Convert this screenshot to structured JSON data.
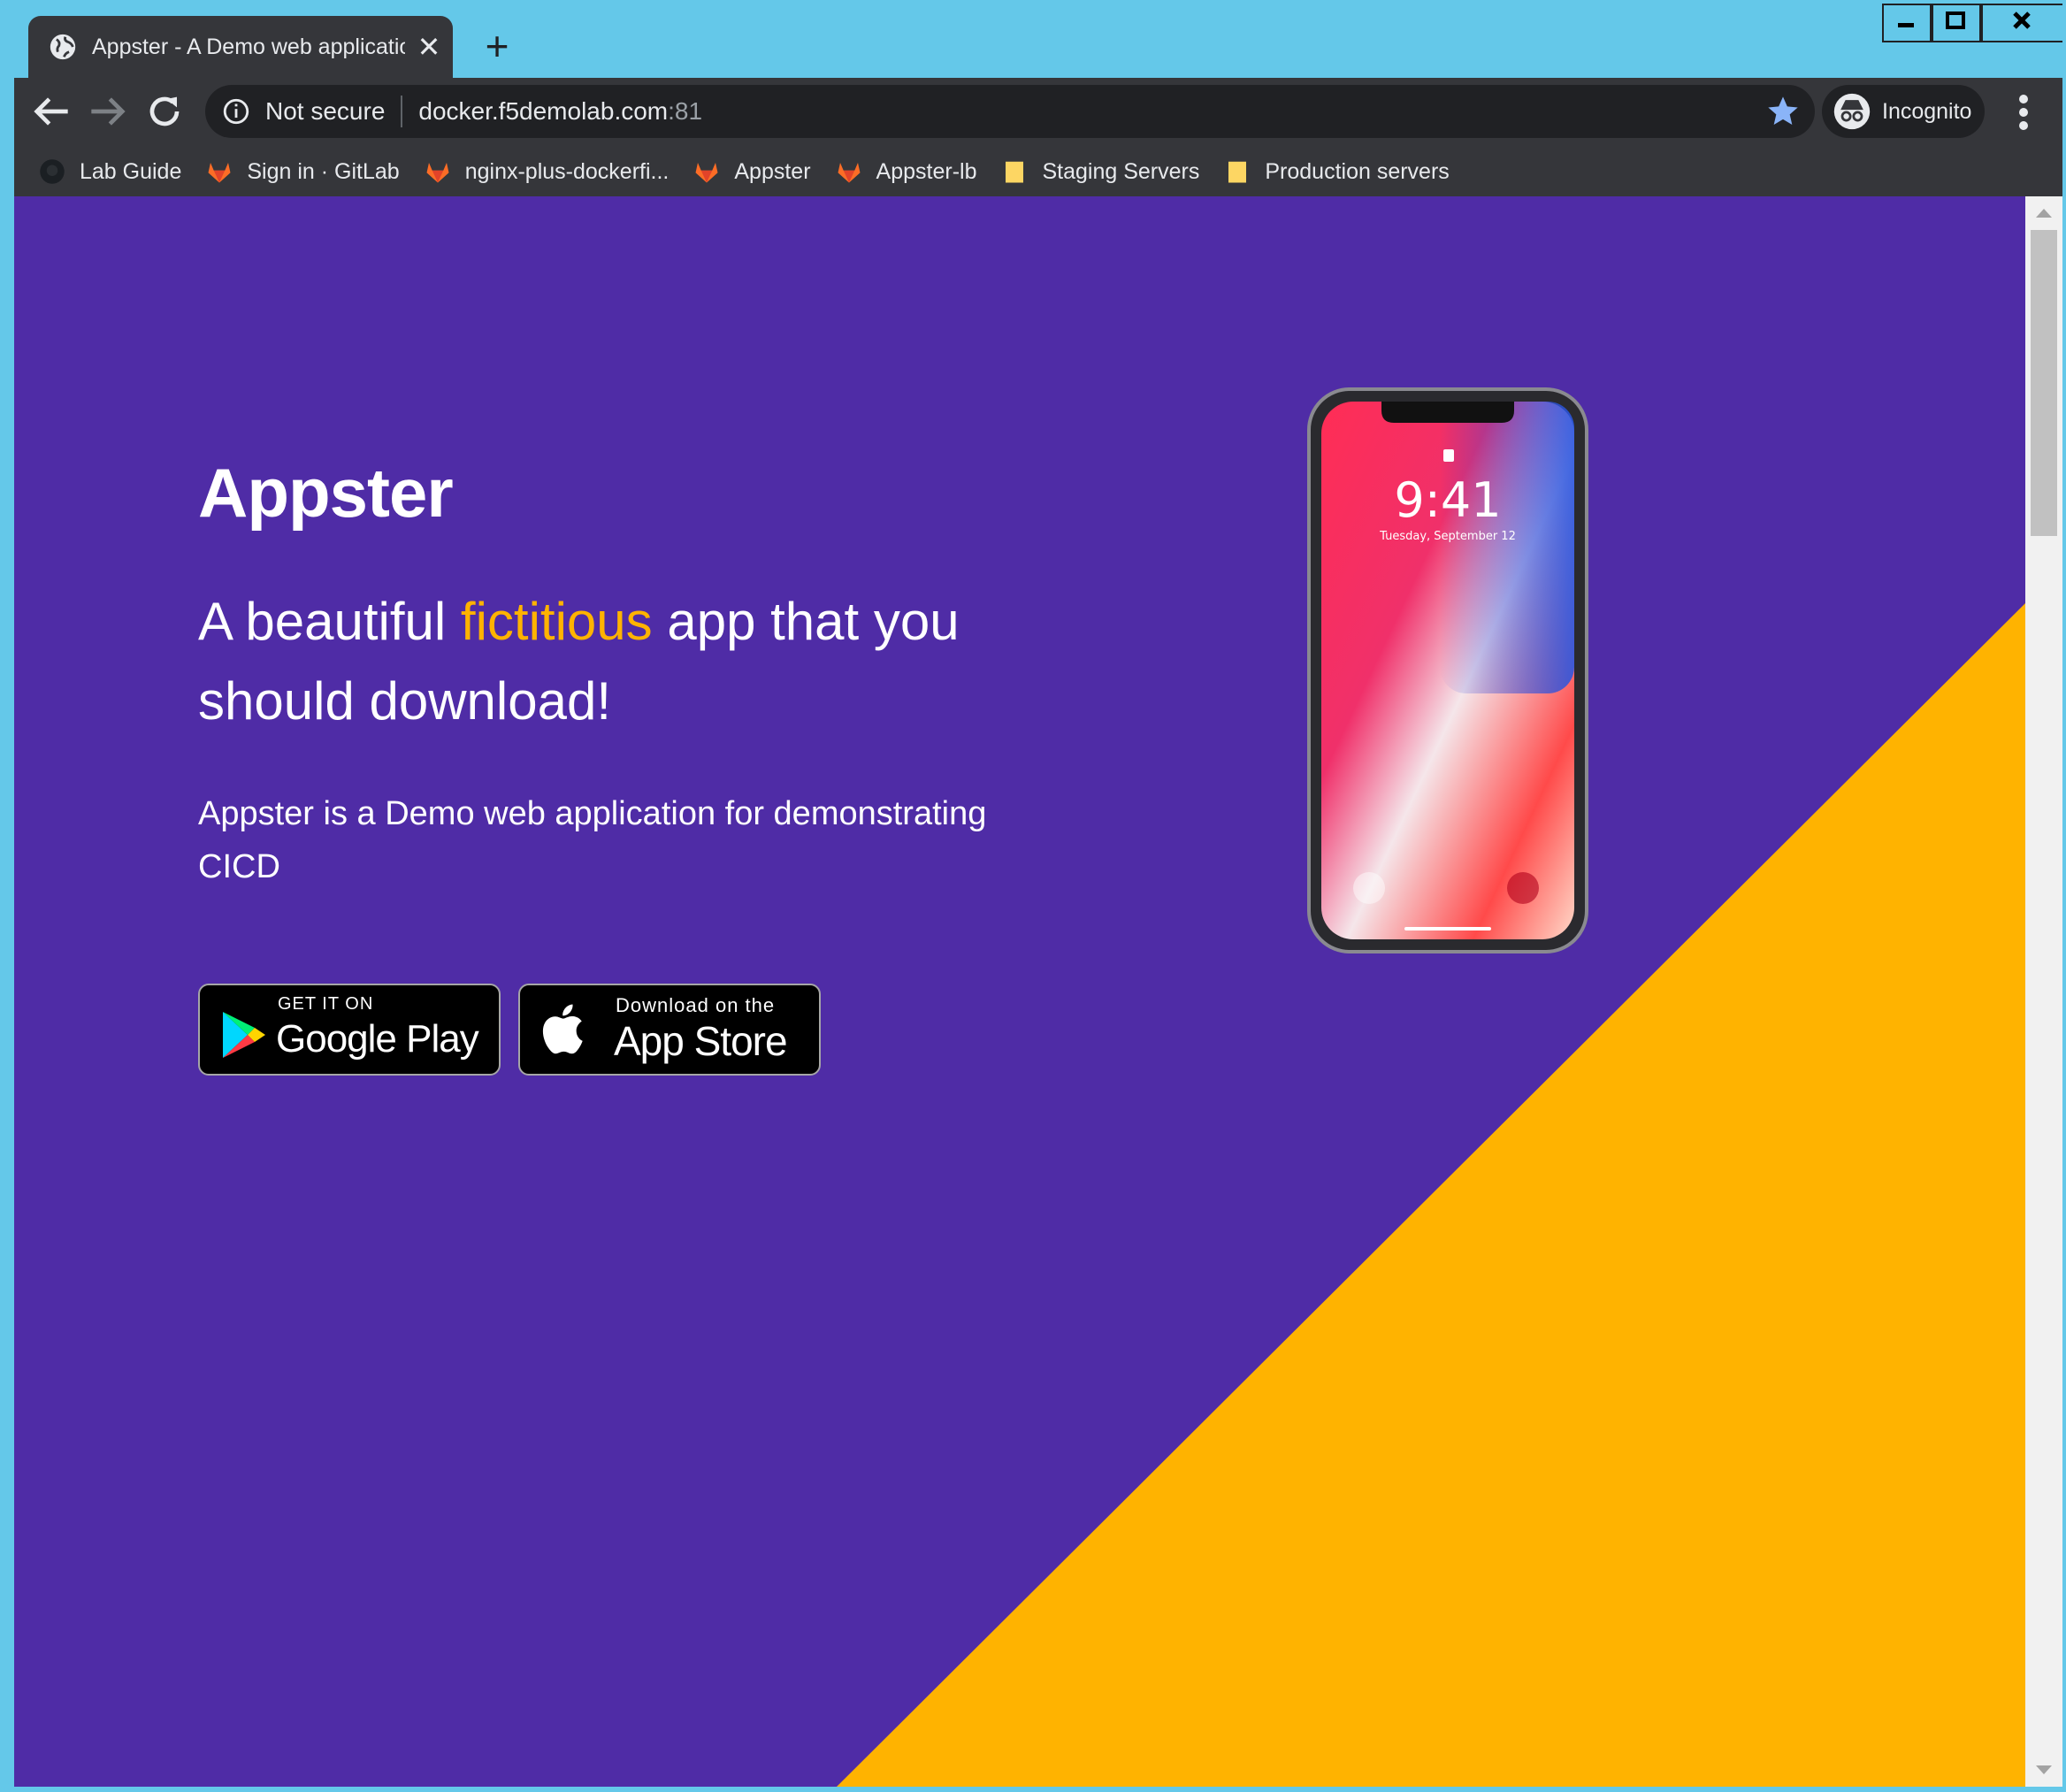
{
  "browser": {
    "tab_title": "Appster - A Demo web applicatio",
    "close_glyph": "✕",
    "new_tab_glyph": "+",
    "not_secure_label": "Not secure",
    "url_host": "docker.f5demolab.com",
    "url_port": ":81",
    "profile_label": "Incognito",
    "icons": {
      "tab": "globe-icon",
      "back": "back-arrow-icon",
      "forward": "forward-arrow-icon",
      "reload": "reload-icon",
      "info": "info-icon",
      "star": "star-icon",
      "incognito": "incognito-icon",
      "menu": "kebab-menu-icon"
    },
    "bookmarks": [
      {
        "label": "Lab Guide",
        "icon": "github-icon"
      },
      {
        "label": "Sign in · GitLab",
        "icon": "gitlab-icon"
      },
      {
        "label": "nginx-plus-dockerfi...",
        "icon": "gitlab-icon"
      },
      {
        "label": "Appster",
        "icon": "gitlab-icon"
      },
      {
        "label": "Appster-lb",
        "icon": "gitlab-icon"
      },
      {
        "label": "Staging Servers",
        "icon": "folder-icon"
      },
      {
        "label": "Production servers",
        "icon": "folder-icon"
      }
    ]
  },
  "page": {
    "title": "Appster",
    "tagline_before": "A beautiful ",
    "tagline_accent": "fictitious",
    "tagline_after": " app that you should download!",
    "description": "Appster is a Demo web application for demonstrating CICD",
    "google_play": {
      "small": "GET IT ON",
      "big": "Google Play"
    },
    "app_store": {
      "small": "Download on the",
      "big": "App Store"
    },
    "phone": {
      "time": "9:41",
      "date": "Tuesday, September 12"
    }
  },
  "colors": {
    "background_purple": "#4f2ca6",
    "accent_yellow": "#ffb300",
    "browser_dark": "#35363a",
    "titlebar_blue": "#64c8e9"
  }
}
